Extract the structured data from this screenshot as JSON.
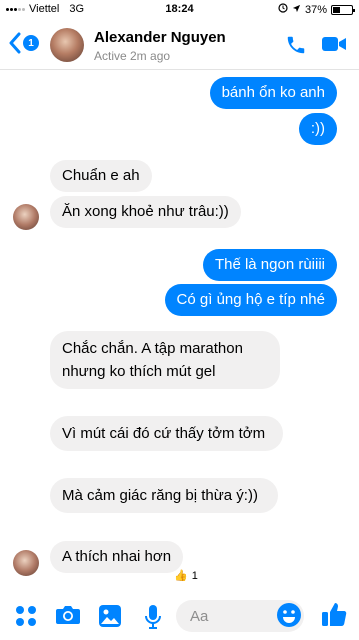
{
  "status_bar": {
    "carrier": "Viettel",
    "network": "3G",
    "time": "18:24",
    "battery": "37%",
    "battery_level": 0.37
  },
  "header": {
    "back_badge": "1",
    "name": "Alexander Nguyen",
    "status": "Active 2m ago",
    "accent_color": "#0084ff"
  },
  "messages": [
    {
      "from": "me",
      "text": "bánh ổn ko anh"
    },
    {
      "from": "me",
      "text": ":))"
    },
    {
      "from": "them",
      "text": "Chuẩn e ah"
    },
    {
      "from": "them",
      "text": "Ăn xong khoẻ như trâu:))"
    },
    {
      "from": "me",
      "text": "Thế là ngon rùiiii"
    },
    {
      "from": "me",
      "text": "Có gì ủng hộ e típ nhé"
    },
    {
      "from": "them",
      "text": "Chắc chắn. A tập marathon nhưng ko thích mút gel"
    },
    {
      "from": "them",
      "text": "Vì mút cái đó cứ thấy tởm tởm"
    },
    {
      "from": "them",
      "text": "Mà cảm giác răng bị thừa ý:))"
    },
    {
      "from": "them",
      "text": "A thích nhai hơn"
    }
  ],
  "reaction": {
    "emoji": "👍",
    "count": "1"
  },
  "composer": {
    "placeholder": "Aa",
    "icons": [
      "apps-icon",
      "camera-icon",
      "gallery-icon",
      "microphone-icon",
      "emoji-icon",
      "like-icon"
    ]
  }
}
